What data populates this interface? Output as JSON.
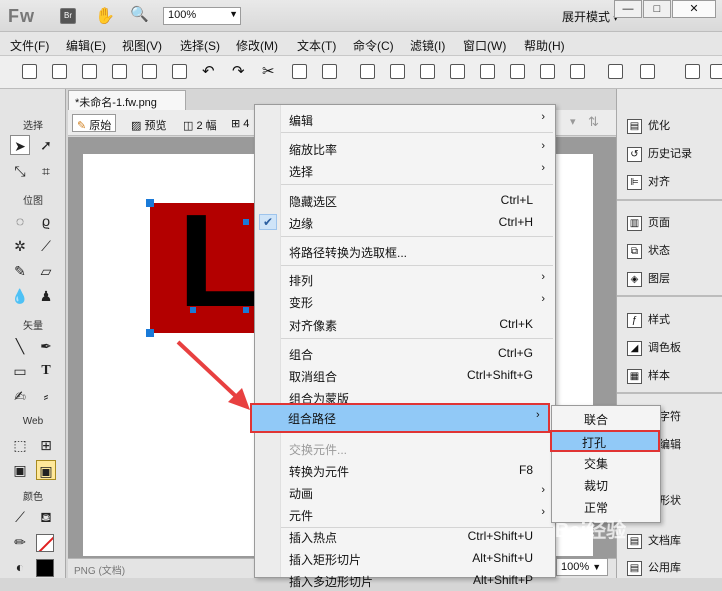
{
  "titlebar": {
    "logo": "Fw",
    "zoom": "100%",
    "workspace": "展开模式"
  },
  "menubar": [
    "文件(F)",
    "编辑(E)",
    "视图(V)",
    "选择(S)",
    "修改(M)",
    "文本(T)",
    "命令(C)",
    "滤镜(I)",
    "窗口(W)",
    "帮助(H)"
  ],
  "tools": {
    "sections": [
      "选择",
      "位图",
      "矢量",
      "Web",
      "颜色"
    ]
  },
  "document": {
    "tab": "*未命名-1.fw.png",
    "btn_original": "原始",
    "btn_preview": "预览",
    "btn_2": "2 幅",
    "btn_4": "4",
    "letter": "L",
    "status": "PNG (文档)",
    "zoom": "100%"
  },
  "panel": {
    "items": [
      "优化",
      "历史记录",
      "对齐",
      "页面",
      "状态",
      "图层",
      "样式",
      "调色板",
      "样本",
      "殊字符",
      "像编辑",
      "径",
      "动形状",
      "文档库",
      "公用库"
    ]
  },
  "context": {
    "items": [
      {
        "label": "编辑",
        "shortcut": "",
        "arrow": true
      },
      {
        "label": "缩放比率",
        "shortcut": "",
        "arrow": true
      },
      {
        "label": "选择",
        "shortcut": "",
        "arrow": true
      },
      {
        "label": "隐藏选区",
        "shortcut": "Ctrl+L",
        "arrow": false
      },
      {
        "label": "边缘",
        "shortcut": "Ctrl+H",
        "arrow": false,
        "checked": true
      },
      {
        "label": "将路径转换为选取框...",
        "shortcut": "",
        "arrow": false
      },
      {
        "label": "排列",
        "shortcut": "",
        "arrow": true
      },
      {
        "label": "变形",
        "shortcut": "",
        "arrow": true
      },
      {
        "label": "对齐像素",
        "shortcut": "Ctrl+K",
        "arrow": false
      },
      {
        "label": "组合",
        "shortcut": "Ctrl+G",
        "arrow": false
      },
      {
        "label": "取消组合",
        "shortcut": "Ctrl+Shift+G",
        "arrow": false
      },
      {
        "label": "组合为蒙版",
        "shortcut": "",
        "arrow": false
      },
      {
        "label": "组合路径",
        "shortcut": "",
        "arrow": true
      },
      {
        "label": "交换元件...",
        "shortcut": "",
        "arrow": false,
        "disabled": true
      },
      {
        "label": "转换为元件",
        "shortcut": "F8",
        "arrow": false
      },
      {
        "label": "动画",
        "shortcut": "",
        "arrow": true
      },
      {
        "label": "元件",
        "shortcut": "",
        "arrow": true
      },
      {
        "label": "插入热点",
        "shortcut": "Ctrl+Shift+U",
        "arrow": false
      },
      {
        "label": "插入矩形切片",
        "shortcut": "Alt+Shift+U",
        "arrow": false
      },
      {
        "label": "插入多边形切片",
        "shortcut": "Alt+Shift+P",
        "arrow": false
      }
    ]
  },
  "submenu": {
    "items": [
      "联合",
      "打孔",
      "交集",
      "裁切",
      "正常"
    ]
  },
  "watermark": "Bai经验"
}
